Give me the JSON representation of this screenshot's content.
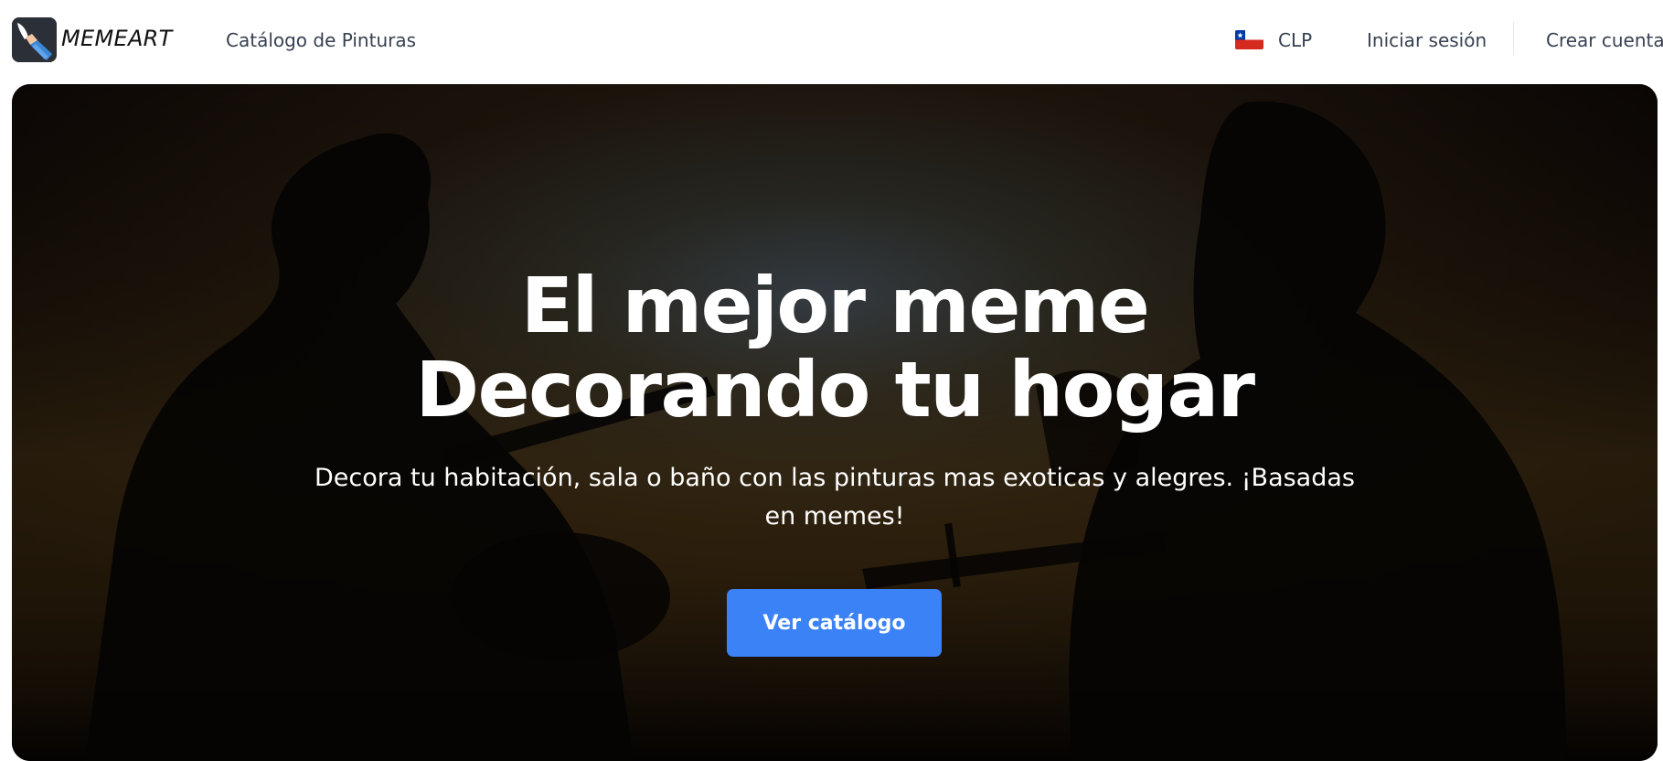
{
  "header": {
    "brand": "MEMEART",
    "nav_catalog": "Catálogo de Pinturas",
    "currency": "CLP",
    "login": "Iniciar sesión",
    "signup": "Crear cuenta"
  },
  "hero": {
    "headline_line1": "El mejor meme",
    "headline_line2": "Decorando tu hogar",
    "subtitle": "Decora tu habitación, sala o baño con las pinturas mas exoticas y alegres. ¡Basadas en memes!",
    "cta_label": "Ver catálogo"
  },
  "colors": {
    "accent": "#3b82f6",
    "text_nav": "#374151",
    "hero_dark": "#0a0705"
  },
  "icons": {
    "logo": "paintbrush-logo-icon",
    "flag": "chile-flag-icon"
  }
}
